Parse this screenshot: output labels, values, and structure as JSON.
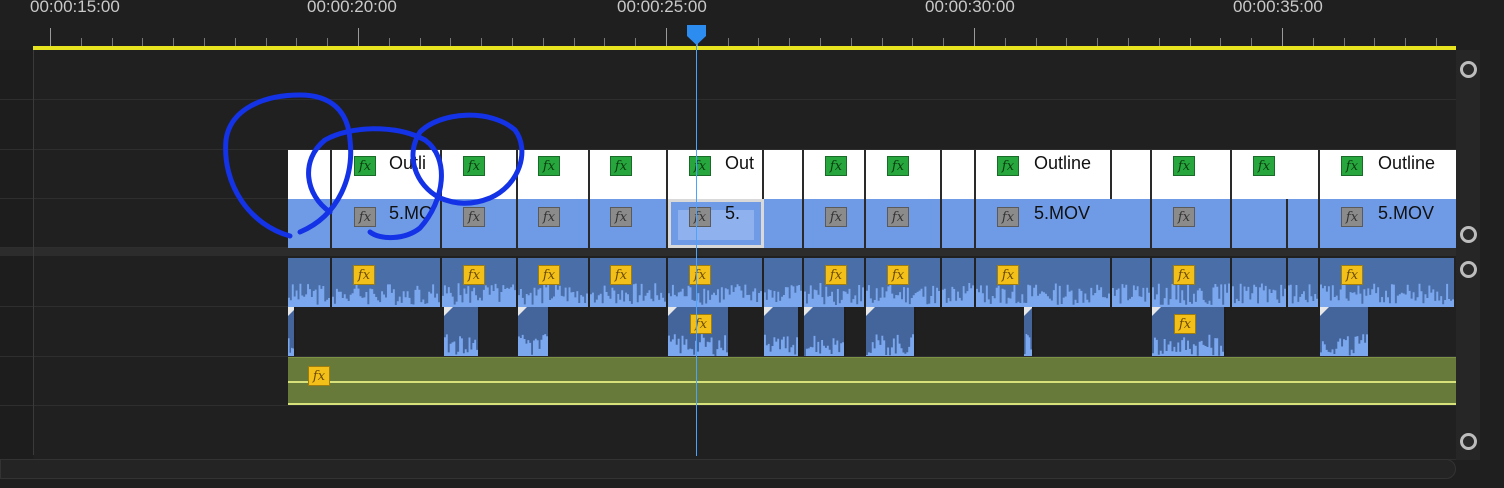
{
  "ruler": {
    "timecodes": [
      "00:00:15:00",
      "00:00:20:00",
      "00:00:25:00",
      "00:00:30:00",
      "00:00:35:00"
    ],
    "playhead_time": "00:00:25:00"
  },
  "tracks": {
    "title_clip_labels": [
      "Outli",
      "Out",
      "Outline",
      "Outline"
    ],
    "video_clip_labels": [
      "5.MO",
      "5.",
      "5.MOV",
      "5.MOV"
    ]
  },
  "icons": {
    "fx": "fx",
    "playhead": "playhead-marker-icon",
    "scroll_knob": "scroll-knob-icon",
    "annotation": "hand-drawn-circles"
  },
  "colors": {
    "work_area_bar": "#e8e31f",
    "title_clip": "#ffffff",
    "video_clip": "#6f9ae6",
    "audio_clip": "#4a6ea8",
    "adjustment_clip": "#687a3a",
    "playhead": "#4aa3ff",
    "fx_green": "#26a63c",
    "fx_yellow": "#f2c019",
    "annotation": "#1432e6"
  }
}
